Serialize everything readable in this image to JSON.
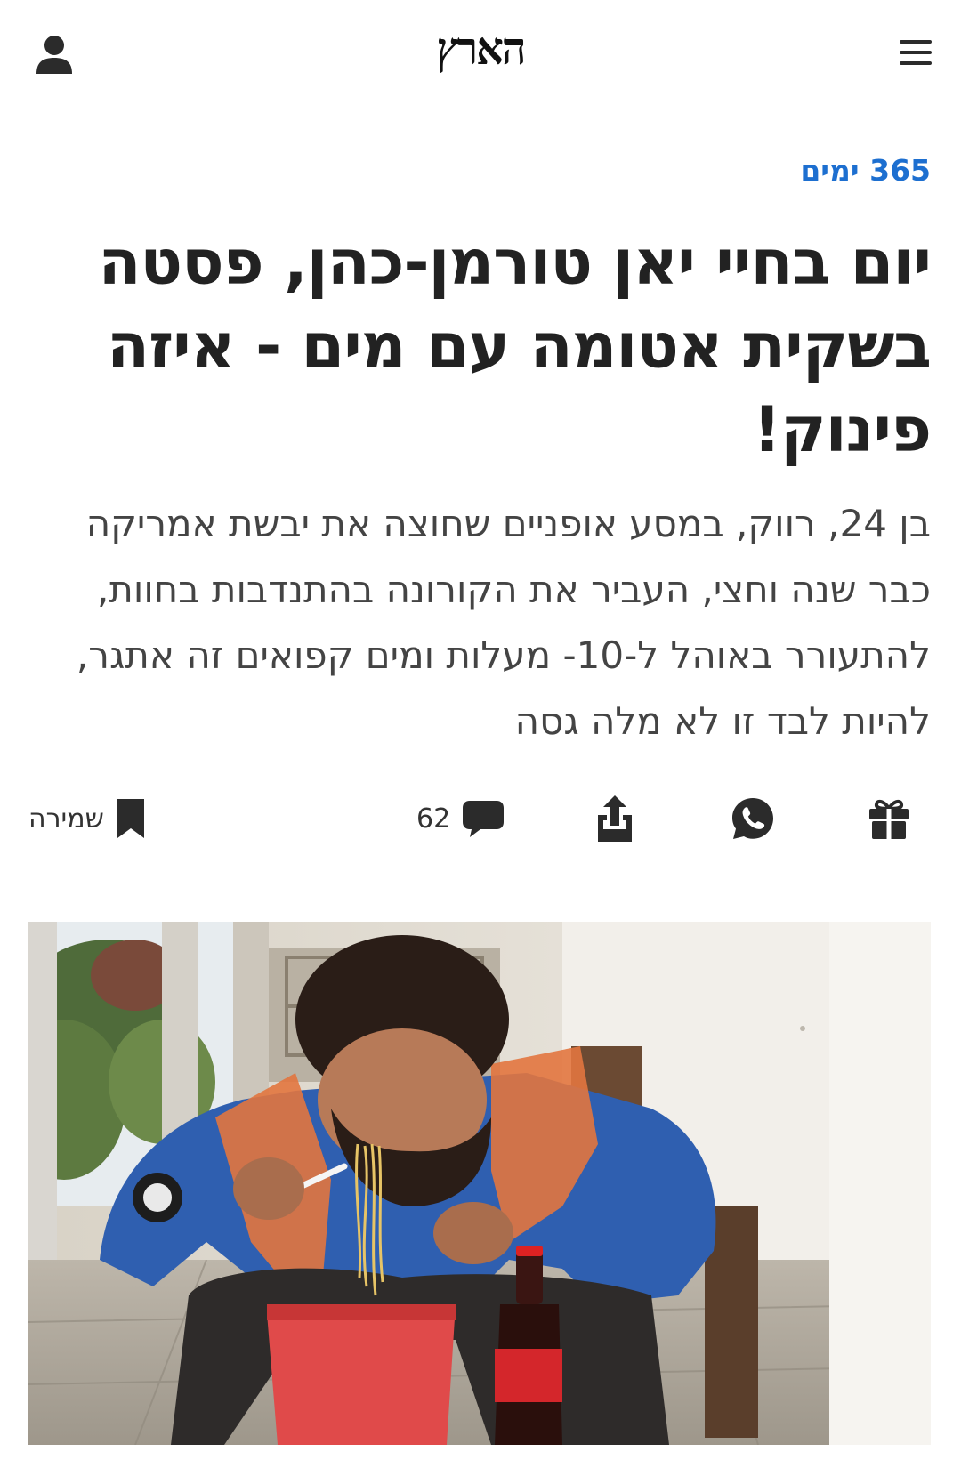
{
  "header": {
    "logo_text": "הארץ",
    "user_icon": "user-icon",
    "menu_icon": "hamburger-menu-icon"
  },
  "article": {
    "kicker": "365 ימים",
    "headline": "יום בחיי יאן טורמן-כהן, פסטה בשקית אטומה עם מים - איזה פינוק!",
    "subtitle": "בן 24, רווק, במסע אופניים שחוצה את יבשת אמריקה כבר שנה וחצי, העביר את הקורונה בהתנדבות בחוות, להתעורר באוהל ל-10- מעלות ומים קפואים זה אתגר, להיות לבד זו לא מלה גסה"
  },
  "actions": {
    "save_label": "שמירה",
    "comments_count": "62",
    "icons": [
      "bookmark-icon",
      "comment-icon",
      "share-icon",
      "whatsapp-icon",
      "gift-icon"
    ]
  },
  "colors": {
    "accent": "#1d6fd0",
    "text": "#222222",
    "icon": "#2b2b2b"
  },
  "photo": {
    "subject": "article-hero-photo"
  }
}
